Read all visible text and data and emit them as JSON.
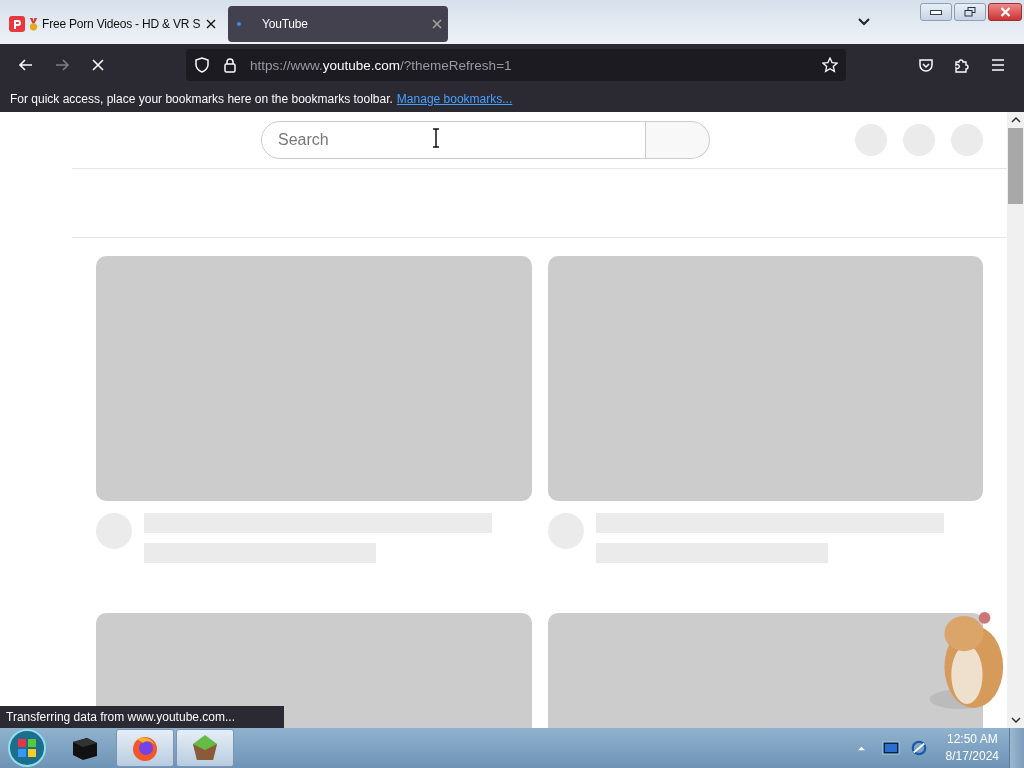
{
  "tabs": [
    {
      "title": "Free Porn Videos - HD & VR S",
      "selected": false,
      "loading": false
    },
    {
      "title": "YouTube",
      "selected": true,
      "loading": true
    }
  ],
  "nav": {
    "loading": true
  },
  "address": {
    "prefix": "https://www.",
    "domain": "youtube.com",
    "path": "/?themeRefresh=1"
  },
  "bookmarks_bar": {
    "message": "For quick access, place your bookmarks here on the bookmarks toolbar.",
    "link": "Manage bookmarks..."
  },
  "search": {
    "placeholder": "Search"
  },
  "feed": {
    "loading": true
  },
  "status_bar": {
    "text": "Transferring data from www.youtube.com..."
  },
  "taskbar": {
    "items": [
      {
        "kind": "box",
        "selected": false
      },
      {
        "kind": "firefox",
        "selected": true
      },
      {
        "kind": "gem",
        "selected": true
      }
    ],
    "clock": {
      "time": "12:50 AM",
      "date": "8/17/2024"
    }
  }
}
